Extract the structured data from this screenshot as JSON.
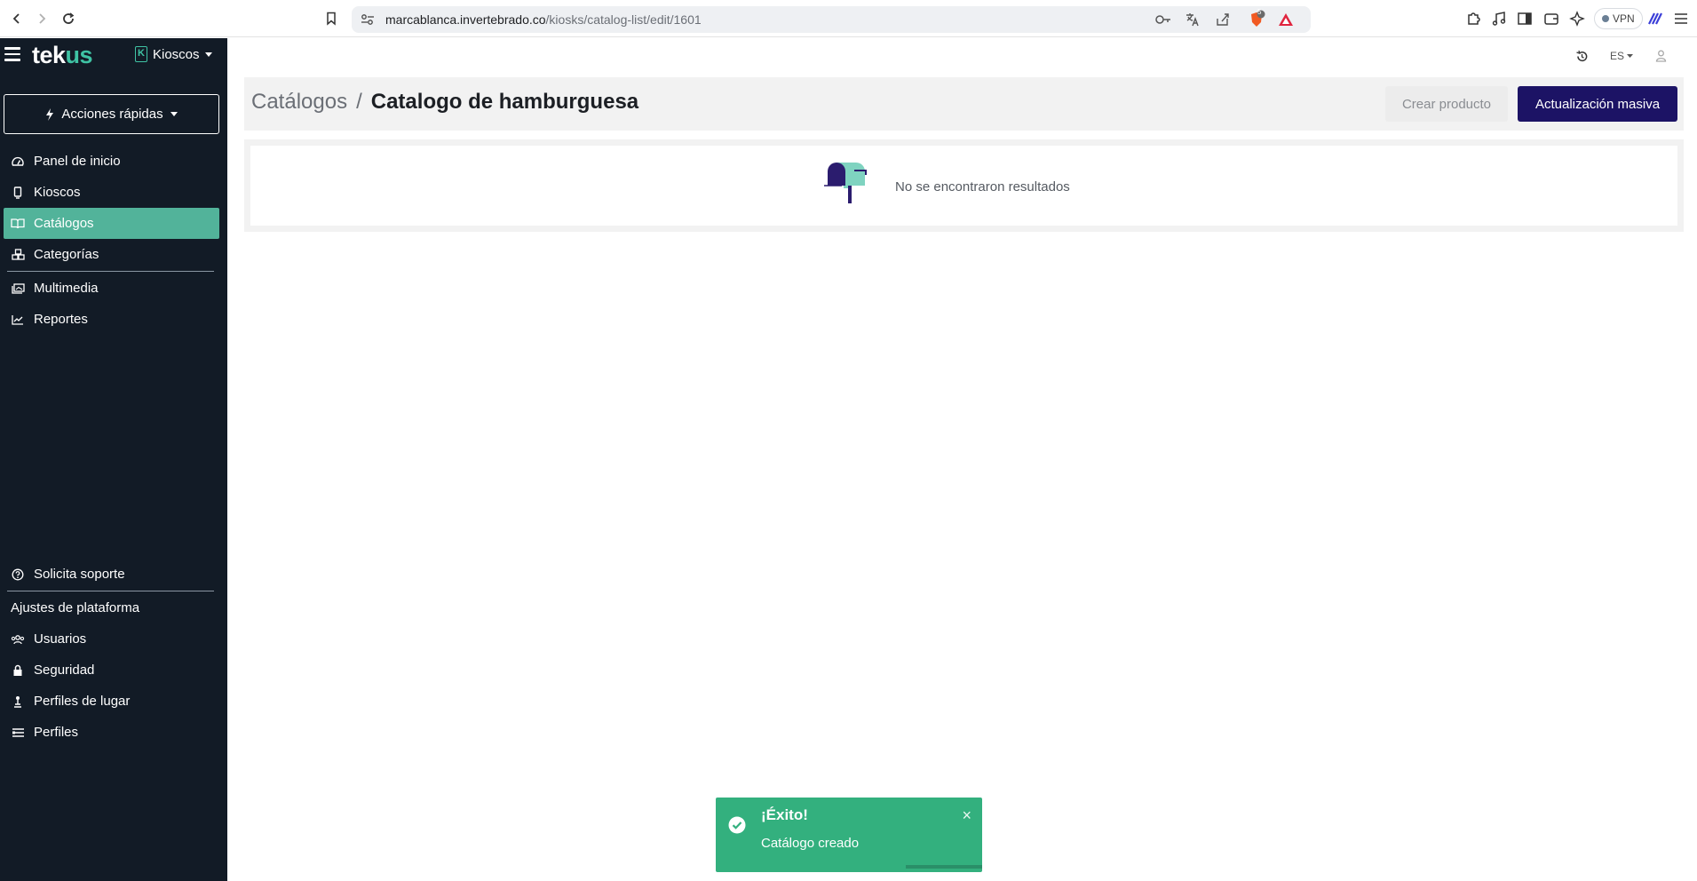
{
  "browser": {
    "url_host": "marcablanca.invertebrado.co",
    "url_path": "/kiosks/catalog-list/edit/1601",
    "vpn_label": "VPN",
    "shield_count": "5"
  },
  "sidebar": {
    "logo_main": "tek",
    "logo_accent": "us",
    "kiosk_badge": "K",
    "kiosk_switch": "Kioscos",
    "quick_actions": "Acciones rápidas",
    "items": [
      {
        "label": "Panel de inicio",
        "icon": "gauge-icon"
      },
      {
        "label": "Kioscos",
        "icon": "kiosk-icon"
      },
      {
        "label": "Catálogos",
        "icon": "book-icon",
        "active": true
      },
      {
        "label": "Categorías",
        "icon": "boxes-icon"
      },
      {
        "label": "Multimedia",
        "icon": "images-icon"
      },
      {
        "label": "Reportes",
        "icon": "chart-line-icon"
      }
    ],
    "support": "Solicita soporte",
    "settings_heading": "Ajustes de plataforma",
    "settings_items": [
      {
        "label": "Usuarios",
        "icon": "users-icon"
      },
      {
        "label": "Seguridad",
        "icon": "lock-icon"
      },
      {
        "label": "Perfiles de lugar",
        "icon": "place-icon"
      },
      {
        "label": "Perfiles",
        "icon": "id-card-icon"
      }
    ]
  },
  "header": {
    "language": "ES"
  },
  "page": {
    "breadcrumb_parent": "Catálogos",
    "breadcrumb_sep": "/",
    "title": "Catalogo de hamburguesa",
    "create_product": "Crear producto",
    "bulk_update": "Actualización masiva",
    "empty_text": "No se encontraron resultados"
  },
  "toast": {
    "title": "¡Éxito!",
    "message": "Catálogo creado",
    "close": "×"
  },
  "colors": {
    "sidebar_bg": "#121b26",
    "active_item": "#52b39a",
    "primary_button": "#1c1365",
    "toast_bg": "#33b07e",
    "accent": "#3fc3a4"
  }
}
